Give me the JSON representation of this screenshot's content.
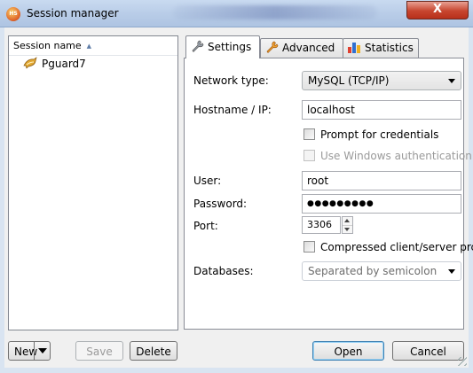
{
  "window": {
    "title": "Session manager",
    "app_icon_text": "HS",
    "close_label": "X"
  },
  "sessions": {
    "column_header": "Session name",
    "items": [
      {
        "label": "Pguard7"
      }
    ]
  },
  "left_buttons": {
    "new_label": "New",
    "save_label": "Save",
    "delete_label": "Delete"
  },
  "tabs": [
    {
      "label": "Settings"
    },
    {
      "label": "Advanced"
    },
    {
      "label": "Statistics"
    }
  ],
  "settings": {
    "network_type_label": "Network type:",
    "network_type_value": "MySQL (TCP/IP)",
    "hostname_label": "Hostname / IP:",
    "hostname_value": "localhost",
    "prompt_credentials_label": "Prompt for credentials",
    "windows_auth_label": "Use Windows authentication",
    "user_label": "User:",
    "user_value": "root",
    "password_label": "Password:",
    "password_value": "●●●●●●●●●",
    "port_label": "Port:",
    "port_value": "3306",
    "compressed_label": "Compressed client/server prc",
    "databases_label": "Databases:",
    "databases_placeholder": "Separated by semicolon"
  },
  "dialog_buttons": {
    "open_label": "Open",
    "cancel_label": "Cancel"
  }
}
